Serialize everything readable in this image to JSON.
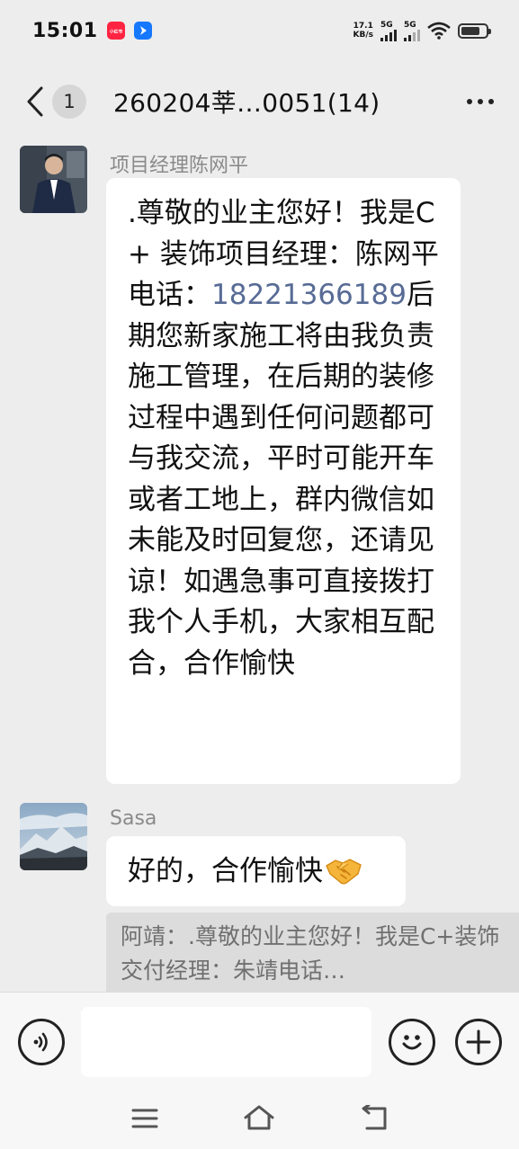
{
  "status_bar": {
    "time": "15:01",
    "app_badge_1": "小红书",
    "net_speed_value": "17.1",
    "net_speed_unit": "KB/s",
    "sim1_label": "5G",
    "sim2_label": "5G",
    "battery_level": 0.75
  },
  "header": {
    "unread_count": "1",
    "title": "260204莘…0051(14)"
  },
  "messages": [
    {
      "sender": "项目经理陈网平",
      "text_before": ".尊敬的业主您好！我是C+ 装饰项目经理：陈网平电话：",
      "phone": "18221366189",
      "text_after": "后期您新家施工将由我负责施工管理，在后期的装修过程中遇到任何问题都可与我交流，平时可能开车或者工地上，群内微信如未能及时回复您，还请见谅！如遇急事可直接拨打我个人手机，大家相互配合，合作愉快"
    },
    {
      "sender": "Sasa",
      "text": "好的，合作愉快",
      "emoji": "handshake-icon"
    }
  ],
  "quoted_preview": "阿靖：.尊敬的业主您好！我是C+装饰交付经理：朱靖电话…",
  "input": {
    "placeholder": ""
  },
  "colors": {
    "background": "#ededed",
    "bubble": "#ffffff",
    "link": "#576b95",
    "sender_name": "#8a8a8a"
  }
}
